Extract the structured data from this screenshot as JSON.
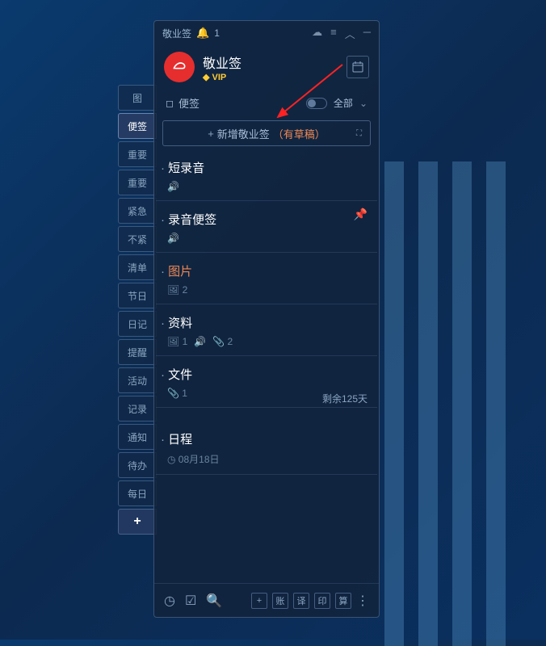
{
  "titlebar": {
    "appName": "敬业签",
    "badge": "1"
  },
  "brand": {
    "name": "敬业签",
    "vip": "VIP"
  },
  "sidebar": {
    "tabs": [
      "图",
      "便签",
      "重要",
      "重要",
      "紧急",
      "不紧",
      "清单",
      "节日",
      "日记",
      "提醒",
      "活动",
      "记录",
      "通知",
      "待办",
      "每日"
    ],
    "activeIndex": 1
  },
  "sectionHead": {
    "label": "便签",
    "filter": "全部"
  },
  "addRow": {
    "label": "新增敬业签",
    "draft": "（有草稿）"
  },
  "notes": [
    {
      "title": "短录音",
      "meta": {
        "sound": true
      }
    },
    {
      "title": "录音便签",
      "meta": {
        "sound": true
      },
      "pinned": true
    },
    {
      "title": "图片",
      "highlight": true,
      "meta": {
        "image": "2"
      }
    },
    {
      "title": "资料",
      "meta": {
        "image": "1",
        "sound": true,
        "attach": "2"
      }
    },
    {
      "title": "文件",
      "meta": {
        "attach": "1"
      }
    },
    {
      "title": "日程",
      "meta": {
        "clock": "08月18日"
      },
      "remaining": "剩余125天"
    }
  ],
  "bottom": {
    "actions": [
      "账",
      "译",
      "印",
      "算"
    ]
  }
}
